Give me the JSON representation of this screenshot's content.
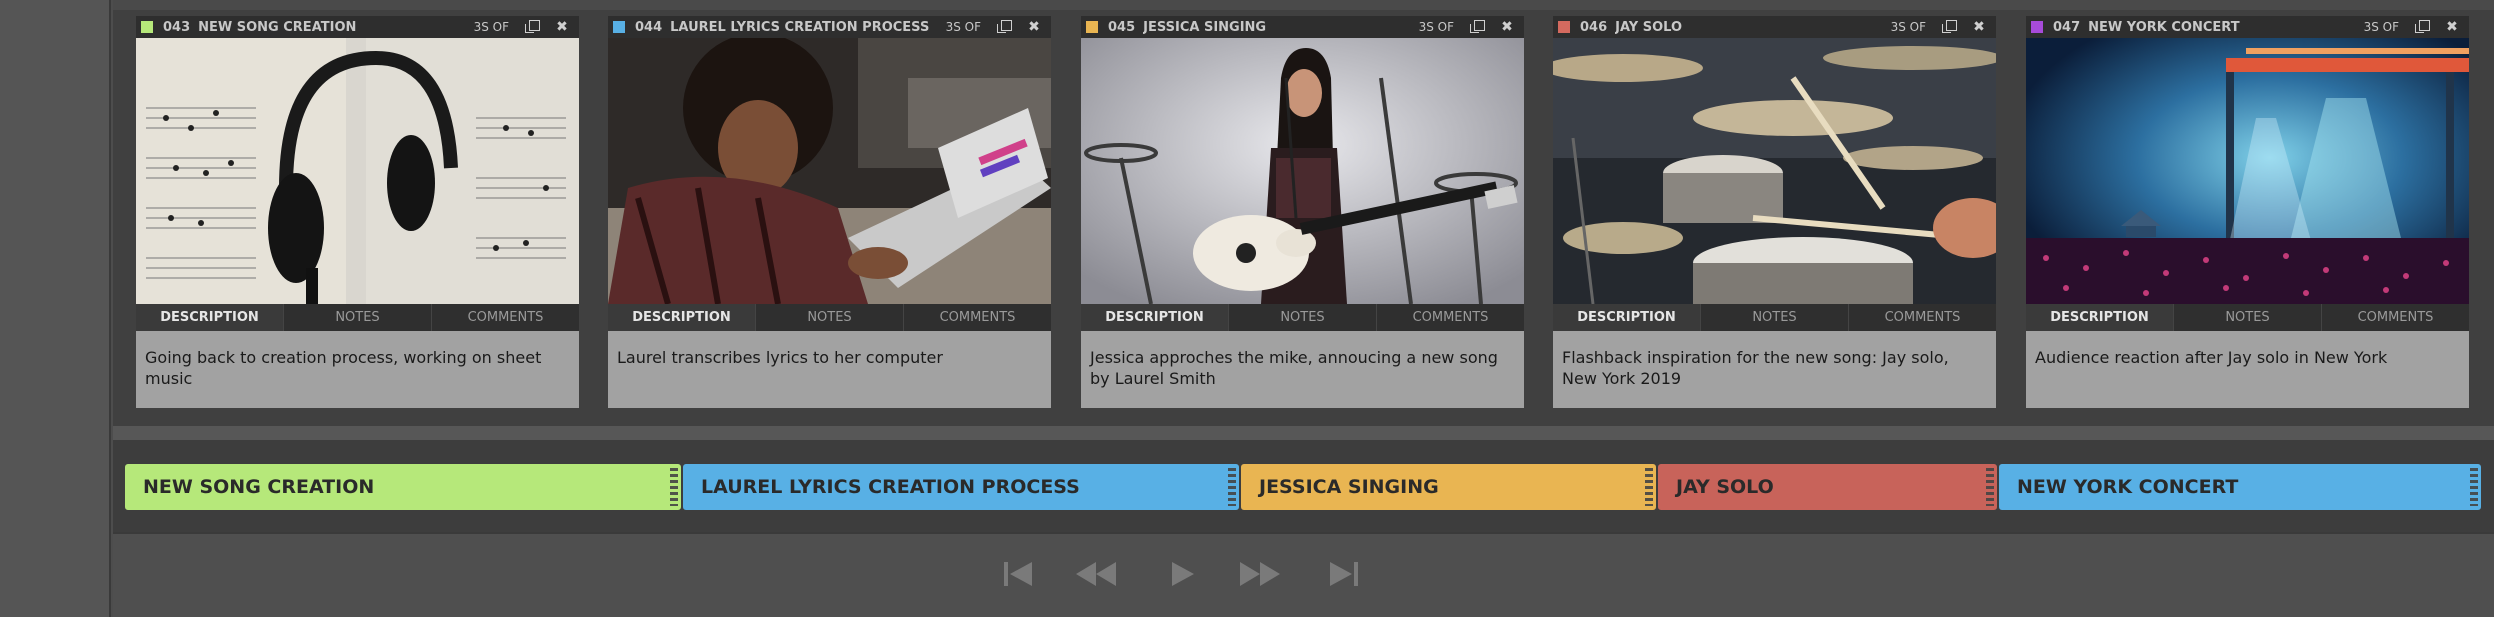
{
  "cards": [
    {
      "number": "043",
      "title": "NEW SONG CREATION",
      "duration": "3S OF",
      "swatch": "#b6e87a",
      "tabs": [
        "DESCRIPTION",
        "NOTES",
        "COMMENTS"
      ],
      "description": "Going back to creation process, working on sheet music"
    },
    {
      "number": "044",
      "title": "LAUREL LYRICS CREATION PROCESS",
      "duration": "3S OF",
      "swatch": "#58b0e5",
      "tabs": [
        "DESCRIPTION",
        "NOTES",
        "COMMENTS"
      ],
      "description": "Laurel transcribes lyrics to her computer"
    },
    {
      "number": "045",
      "title": "JESSICA SINGING",
      "duration": "3S OF",
      "swatch": "#e9b552",
      "tabs": [
        "DESCRIPTION",
        "NOTES",
        "COMMENTS"
      ],
      "description": "Jessica approches the mike, annoucing a new song by Laurel Smith"
    },
    {
      "number": "046",
      "title": "JAY SOLO",
      "duration": "3S OF",
      "swatch": "#d46a5f",
      "tabs": [
        "DESCRIPTION",
        "NOTES",
        "COMMENTS"
      ],
      "description": "Flashback inspiration for the new song: Jay solo, New York 2019"
    },
    {
      "number": "047",
      "title": "NEW YORK CONCERT",
      "duration": "3S OF",
      "swatch": "#a74bd9",
      "tabs": [
        "DESCRIPTION",
        "NOTES",
        "COMMENTS"
      ],
      "description": "Audience reaction after Jay solo in New York"
    }
  ],
  "timeline": [
    {
      "label": "NEW SONG CREATION",
      "color": "#b6e87a"
    },
    {
      "label": "LAUREL LYRICS CREATION PROCESS",
      "color": "#58b0e5"
    },
    {
      "label": "JESSICA SINGING",
      "color": "#e9b552"
    },
    {
      "label": "JAY SOLO",
      "color": "#c8635a"
    },
    {
      "label": "NEW YORK CONCERT",
      "color": "#58b0e5"
    }
  ],
  "icons": {
    "copy": "copy-icon",
    "close": "close-icon",
    "transport": [
      "skip-to-start-icon",
      "rewind-icon",
      "play-icon",
      "fast-forward-icon",
      "skip-to-end-icon"
    ]
  }
}
